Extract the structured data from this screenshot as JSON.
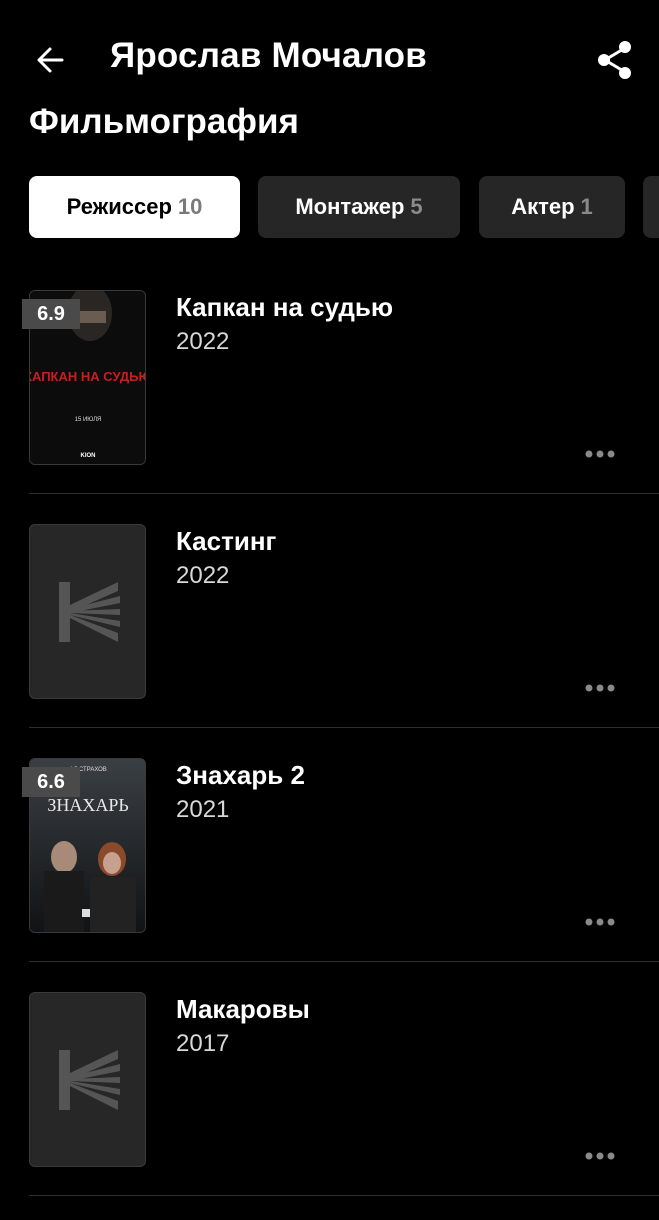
{
  "header": {
    "title": "Ярослав Мочалов"
  },
  "section_title": "Фильмография",
  "tabs": [
    {
      "label": "Режиссер",
      "count": "10",
      "active": true
    },
    {
      "label": "Монтажер",
      "count": "5",
      "active": false
    },
    {
      "label": "Актер",
      "count": "1",
      "active": false
    }
  ],
  "films": [
    {
      "title": "Капкан на судью",
      "year": "2022",
      "rating": "6.9",
      "poster": {
        "headline": "КАПКАН НА СУДЬЮ",
        "date": "15 ИЮЛЯ",
        "brand": "KION"
      }
    },
    {
      "title": "Кастинг",
      "year": "2022",
      "rating": null
    },
    {
      "title": "Знахарь 2",
      "year": "2021",
      "rating": "6.6",
      "poster": {
        "headline": "ЗНАХАРЬ",
        "top_text": "АЛ СТРАХОВ"
      }
    },
    {
      "title": "Макаровы",
      "year": "2017",
      "rating": null
    }
  ],
  "colors": {
    "background": "#000000",
    "tab_inactive": "#262626",
    "tab_active": "#ffffff",
    "rating_badge": "#4a4a4a",
    "placeholder_logo": "#555555"
  }
}
